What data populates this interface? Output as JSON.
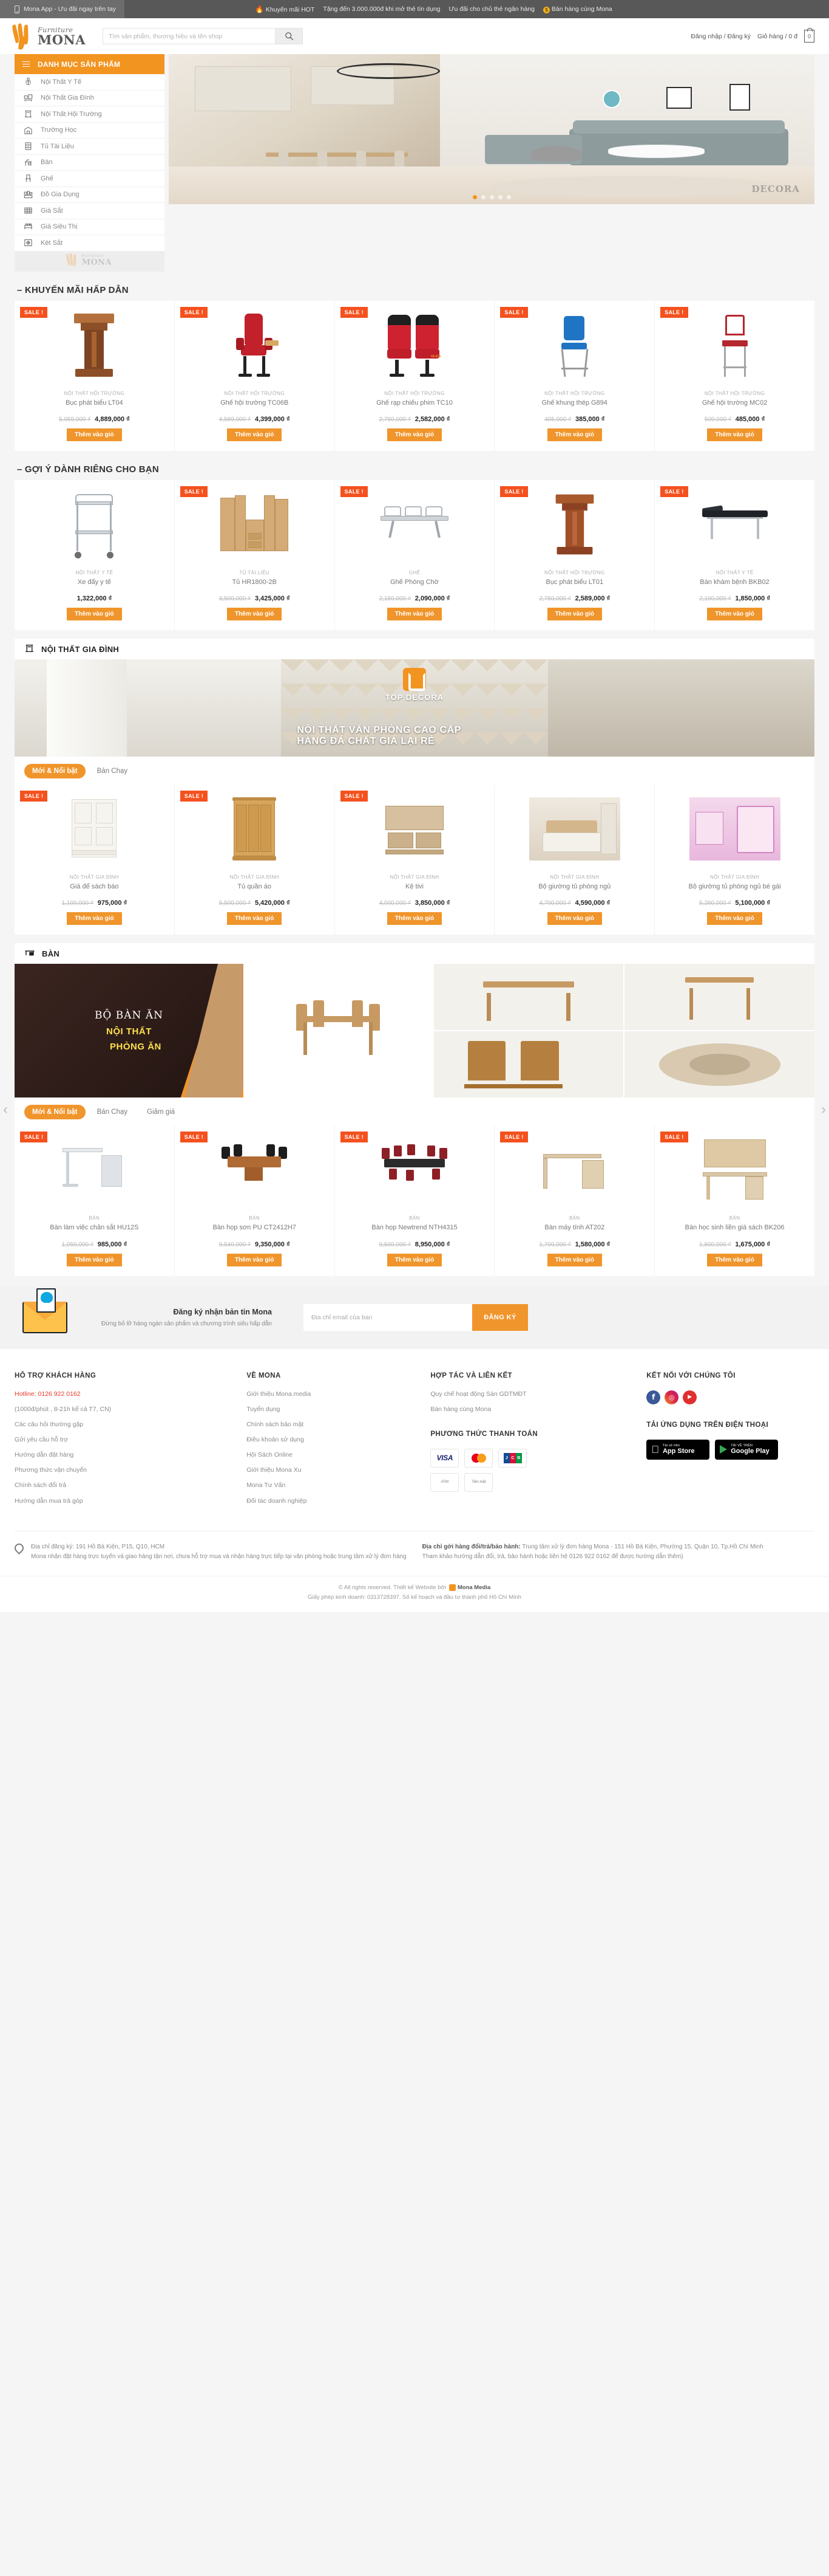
{
  "topbar": {
    "app_label": "Mona App - Ưu đãi ngay trên tay",
    "promos": [
      {
        "icon": "fire-icon",
        "label": "Khuyến mãi HOT"
      },
      {
        "icon": "none",
        "label": "Tặng đến 3.000.000đ khi mở thẻ tín dụng"
      },
      {
        "icon": "none",
        "label": "Ưu đãi cho chủ thẻ ngân hàng"
      },
      {
        "icon": "coin-icon",
        "label": "Bán hàng cùng Mona"
      }
    ]
  },
  "header": {
    "logo_script": "Furniture",
    "logo_word": "MONA",
    "search_placeholder": "Tìm sản phẩm, thương hiệu và tên shop",
    "search_value": "",
    "login": "Đăng nhập / Đăng ký",
    "cart_label": "Giỏ hàng / 0 đ",
    "cart_count": "0"
  },
  "sidebar": {
    "title": "DANH MỤC SẢN PHẨM",
    "items": [
      {
        "label": "Nội Thất Y Tế",
        "icon": "medical-chair-icon"
      },
      {
        "label": "Nội Thất Gia Đình",
        "icon": "home-furniture-icon"
      },
      {
        "label": "Nội Thất Hội Trường",
        "icon": "podium-icon"
      },
      {
        "label": "Trường Học",
        "icon": "school-icon"
      },
      {
        "label": "Tủ Tài Liệu",
        "icon": "file-cabinet-icon"
      },
      {
        "label": "Bàn",
        "icon": "desk-icon"
      },
      {
        "label": "Ghế",
        "icon": "chair-icon"
      },
      {
        "label": "Đồ Gia Dụng",
        "icon": "appliance-icon"
      },
      {
        "label": "Giá Sắt",
        "icon": "steel-rack-icon"
      },
      {
        "label": "Giá Siêu Thị",
        "icon": "supermarket-rack-icon"
      },
      {
        "label": "Két Sắt",
        "icon": "safe-box-icon"
      }
    ]
  },
  "hero": {
    "watermark": "DECORA",
    "dots": 5,
    "active_dot": 1
  },
  "sections": {
    "promo": {
      "title": "– KHUYẾN MÃI HẤP DẪN",
      "products": [
        {
          "cat": "NỘI THẤT HỘI TRƯỜNG",
          "name": "Bục phát biểu LT04",
          "old": "5,059,000 ₫",
          "new": "4,889,000 ₫",
          "badge": "SALE !",
          "btn": "Thêm vào giỏ",
          "art": "podium"
        },
        {
          "cat": "NỘI THẤT HỘI TRƯỜNG",
          "name": "Ghế hội trường TC06B",
          "old": "4,589,000 ₫",
          "new": "4,399,000 ₫",
          "badge": "SALE !",
          "btn": "Thêm vào giỏ",
          "art": "redchair"
        },
        {
          "cat": "NỘI THẤT HỘI TRƯỜNG",
          "name": "Ghế rạp chiếu phim TC10",
          "old": "2,750,000 ₫",
          "new": "2,582,000 ₫",
          "badge": "SALE !",
          "btn": "Thêm vào giỏ",
          "art": "cinema"
        },
        {
          "cat": "NỘI THẤT HỘI TRƯỜNG",
          "name": "Ghế khung thép G894",
          "old": "405,000 ₫",
          "new": "385,000 ₫",
          "badge": "SALE !",
          "btn": "Thêm vào giỏ",
          "art": "bluechair"
        },
        {
          "cat": "NỘI THẤT HỘI TRƯỜNG",
          "name": "Ghế hội trường MC02",
          "old": "500,000 ₫",
          "new": "485,000 ₫",
          "badge": "SALE !",
          "btn": "Thêm vào giỏ",
          "art": "banquet"
        }
      ]
    },
    "suggest": {
      "title": "– GỢI Ý DÀNH RIÊNG CHO BẠN",
      "products": [
        {
          "cat": "NỘI THẤT Y TẾ",
          "name": "Xe đẩy y tế",
          "old": "",
          "new": "1,322,000 ₫",
          "badge": "",
          "btn": "Thêm vào giỏ",
          "art": "trolley"
        },
        {
          "cat": "TỦ TÀI LIỆU",
          "name": "Tủ HR1800-2B",
          "old": "3,500,000 ₫",
          "new": "3,425,000 ₫",
          "badge": "SALE !",
          "btn": "Thêm vào giỏ",
          "art": "cabset"
        },
        {
          "cat": "GHẾ",
          "name": "Ghế Phòng Chờ",
          "old": "2,150,000 ₫",
          "new": "2,090,000 ₫",
          "badge": "SALE !",
          "btn": "Thêm vào giỏ",
          "art": "benchsofa"
        },
        {
          "cat": "NỘI THẤT HỘI TRƯỜNG",
          "name": "Bục phát biểu LT01",
          "old": "2,750,000 ₫",
          "new": "2,589,000 ₫",
          "badge": "SALE !",
          "btn": "Thêm vào giỏ",
          "art": "podium2"
        },
        {
          "cat": "NỘI THẤT Y TẾ",
          "name": "Bàn khám bệnh BKB02",
          "old": "2,100,000 ₫",
          "new": "1,850,000 ₫",
          "badge": "SALE !",
          "btn": "Thêm vào giỏ",
          "art": "exambed"
        }
      ]
    },
    "family": {
      "head": "NỘI THẤT GIA ĐÌNH",
      "head_icon": "podium-icon",
      "banner_brand": "TOP DECORA",
      "banner_line1": "NỘI THẤT VĂN PHÒNG CAO CẤP",
      "banner_line2": "HÀNG ĐÁ CHẤT GIÁ LẠI RẺ",
      "tabs": [
        {
          "label": "Mới & Nổi bật",
          "active": true
        },
        {
          "label": "Bán Chạy",
          "active": false
        }
      ],
      "products": [
        {
          "cat": "NỘI THẤT GIA ĐÌNH",
          "name": "Giá để sách báo",
          "old": "1,100,000 ₫",
          "new": "975,000 ₫",
          "badge": "SALE !",
          "btn": "Thêm vào giỏ",
          "art": "shelfwhite"
        },
        {
          "cat": "NỘI THẤT GIA ĐÌNH",
          "name": "Tủ quần áo",
          "old": "5,500,000 ₫",
          "new": "5,420,000 ₫",
          "badge": "SALE !",
          "btn": "Thêm vào giỏ",
          "art": "wardrobe"
        },
        {
          "cat": "NỘI THẤT GIA ĐÌNH",
          "name": "Kệ tivi",
          "old": "4,000,000 ₫",
          "new": "3,850,000 ₫",
          "badge": "SALE !",
          "btn": "Thêm vào giỏ",
          "art": "tvstand"
        },
        {
          "cat": "NỘI THẤT GIA ĐÌNH",
          "name": "Bộ giường tủ phòng ngủ",
          "old": "4,700,000 ₫",
          "new": "4,590,000 ₫",
          "badge": "SALE !",
          "btn": "Thêm vào giỏ",
          "art": "bedset"
        },
        {
          "cat": "NỘI THẤT GIA ĐÌNH",
          "name": "Bộ giường tủ phòng ngủ bé gái",
          "old": "5,260,000 ₫",
          "new": "5,100,000 ₫",
          "badge": "SALE !",
          "btn": "Thêm vào giỏ",
          "art": "kidroom"
        }
      ]
    },
    "table": {
      "head": "BÀN",
      "head_icon": "desk-icon",
      "banner_t1": "BỘ BÀN ĂN",
      "banner_t2": "NỘI THẤT",
      "banner_t3": "PHÒNG ĂN",
      "tabs": [
        {
          "label": "Mới & Nổi bật",
          "active": true
        },
        {
          "label": "Bán Chạy",
          "active": false
        },
        {
          "label": "Giảm giá",
          "active": false
        }
      ],
      "products": [
        {
          "cat": "BÀN",
          "name": "Bàn làm việc chân sắt HU12S",
          "old": "1,050,000 ₫",
          "new": "985,000 ₫",
          "badge": "SALE !",
          "btn": "Thêm vào giỏ",
          "art": "deskgrey"
        },
        {
          "cat": "BÀN",
          "name": "Bàn họp sơn PU CT2412H7",
          "old": "9,540,000 ₫",
          "new": "9,350,000 ₫",
          "badge": "SALE !",
          "btn": "Thêm vào giỏ",
          "art": "meetwood"
        },
        {
          "cat": "BÀN",
          "name": "Bàn họp Newtrend NTH4315",
          "old": "9,500,000 ₫",
          "new": "8,950,000 ₫",
          "badge": "SALE !",
          "btn": "Thêm vào giỏ",
          "art": "meetred"
        },
        {
          "cat": "BÀN",
          "name": "Bàn máy tính AT202",
          "old": "1,700,000 ₫",
          "new": "1,580,000 ₫",
          "badge": "SALE !",
          "btn": "Thêm vào giỏ",
          "art": "pcdesk"
        },
        {
          "cat": "BÀN",
          "name": "Bàn học sinh liền giá sách BK206",
          "old": "1,800,000 ₫",
          "new": "1,675,000 ₫",
          "badge": "SALE !",
          "btn": "Thêm vào giỏ",
          "art": "studydesk"
        }
      ]
    }
  },
  "newsletter": {
    "title": "Đăng ký nhận bản tin Mona",
    "subtitle": "Đừng bỏ lỡ hàng ngàn sản phẩm và chương trình siêu hấp dẫn",
    "placeholder": "Địa chỉ email của bạn",
    "value": "",
    "button": "ĐĂNG KÝ"
  },
  "footer": {
    "col1": {
      "title": "HỖ TRỢ KHÁCH HÀNG",
      "hotline": "Hotline: 0126 922 0162",
      "note": "(1000đ/phút , 8-21h kể cả T7, CN)",
      "links": [
        "Các câu hỏi thường gặp",
        "Gửi yêu cầu hỗ trợ",
        "Hướng dẫn đặt hàng",
        "Phương thức vận chuyển",
        "Chính sách đổi trả",
        "Hướng dẫn mua trả góp"
      ]
    },
    "col2": {
      "title": "VỀ MONA",
      "links": [
        "Giới thiệu Mona.media",
        "Tuyển dụng",
        "Chính sách bảo mật",
        "Điều khoản sử dụng",
        "Hội Sách Online",
        "Giới thiệu Mona Xu",
        "Mona Tư Vấn",
        "Đối tác doanh nghiệp"
      ]
    },
    "col3": {
      "title": "HỢP TÁC VÀ LIÊN KẾT",
      "links": [
        "Quy chế hoạt động Sàn GDTMĐT",
        "Bán hàng cùng Mona"
      ],
      "pay_title": "PHƯƠNG THỨC THANH TOÁN",
      "pay_cards": [
        "VISA",
        "MasterCard",
        "JCB",
        "ATM",
        "Tiền mặt"
      ]
    },
    "col4": {
      "title": "KẾT NỐI VỚI CHÚNG TÔI",
      "socials": [
        "facebook-icon",
        "instagram-icon",
        "youtube-icon"
      ],
      "app_title": "TẢI ỨNG DỤNG TRÊN ĐIỆN THOẠI",
      "apps": [
        {
          "small": "Tải về trên",
          "big": "App Store",
          "icon": "apple-icon"
        },
        {
          "small": "TẢI VỀ TRÊN",
          "big": "Google Play",
          "icon": "google-play-icon"
        }
      ]
    },
    "address_left": "Địa chỉ đăng ký: 191 Hồ Bá Kiện, P15, Q10, HCM",
    "address_left_note": "Mona nhận đặt hàng trực tuyến và giao hàng tận nơi, chưa hỗ trợ mua và nhận hàng trực tiếp tại văn phòng hoặc trung tâm xử lý đơn hàng",
    "address_right_label": "Địa chỉ gởi hàng đổi/trả/bảo hành:",
    "address_right": "Trung tâm xử lý đơn hàng Mona - 151 Hồ Bá Kiện, Phường 15, Quận 10, Tp.Hồ Chí Minh",
    "address_right_note": "Tham khảo hướng dẫn đổi, trả, bảo hành hoặc liên hệ 0126 922 0162 để được hướng dẫn thêm)"
  },
  "copyright": {
    "line1": "© All rights reserved. Thiết kế Website bởi",
    "brand": "Mona Media",
    "line2": "Giấy phép kinh doanh: 0313728397. Số kế hoạch và đầu tư thành phố Hồ Chí Minh"
  },
  "colors": {
    "accent": "#f0952c",
    "sale": "#f4511e",
    "topbar": "#585858",
    "hotline": "#e8392a"
  }
}
